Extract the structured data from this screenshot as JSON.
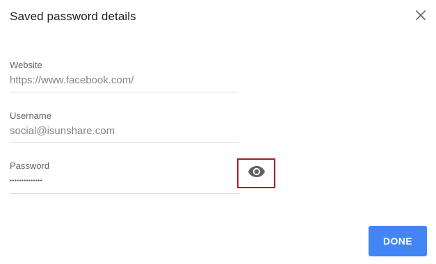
{
  "dialog": {
    "title": "Saved password details",
    "close_icon": "close-icon"
  },
  "fields": {
    "website": {
      "label": "Website",
      "value": "https://www.facebook.com/"
    },
    "username": {
      "label": "Username",
      "value": "social@isunshare.com"
    },
    "password": {
      "label": "Password",
      "value": "••••••••••••••",
      "reveal_icon": "eye-icon"
    }
  },
  "actions": {
    "done_label": "DONE"
  },
  "colors": {
    "accent": "#4285f4",
    "highlight_border": "#a51c24",
    "icon": "#5f6368"
  }
}
